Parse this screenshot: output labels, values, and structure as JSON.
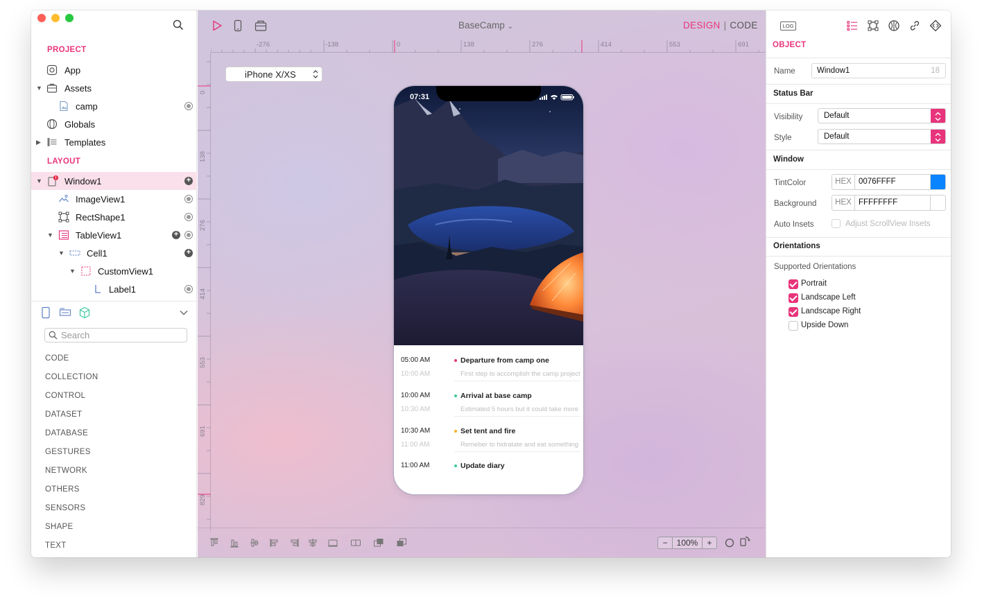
{
  "window": {
    "title": "BaseCamp"
  },
  "left_panel": {
    "project_title": "PROJECT",
    "project_items": [
      {
        "label": "App"
      },
      {
        "label": "Assets"
      },
      {
        "label": "camp"
      },
      {
        "label": "Globals"
      },
      {
        "label": "Templates"
      }
    ],
    "layout_title": "LAYOUT",
    "layout_items": [
      {
        "label": "Window1",
        "selected": true
      },
      {
        "label": "ImageView1"
      },
      {
        "label": "RectShape1"
      },
      {
        "label": "TableView1"
      },
      {
        "label": "Cell1"
      },
      {
        "label": "CustomView1"
      },
      {
        "label": "Label1"
      }
    ],
    "search_placeholder": "Search",
    "library_categories": [
      "CODE",
      "COLLECTION",
      "CONTROL",
      "DATASET",
      "DATABASE",
      "GESTURES",
      "NETWORK",
      "OTHERS",
      "SENSORS",
      "SHAPE",
      "TEXT"
    ]
  },
  "canvas": {
    "mode_design": "DESIGN",
    "mode_separator": "|",
    "mode_code": "CODE",
    "ruler_h": [
      "-276",
      "-138",
      "0",
      "138",
      "276",
      "414",
      "553",
      "691"
    ],
    "ruler_v": [
      "0",
      "138",
      "276",
      "414",
      "553",
      "691",
      "829"
    ],
    "device": "iPhone X/XS",
    "zoom": "100%",
    "zoom_minus": "−",
    "zoom_plus": "+"
  },
  "phone": {
    "time": "07:31",
    "timeline": [
      {
        "start": "05:00 AM",
        "end": "10:00 AM",
        "title": "Departure from camp one",
        "desc": "First step to accomplish the camp project",
        "dot": "#e8347b"
      },
      {
        "start": "10:00 AM",
        "end": "10:30 AM",
        "title": "Arrival at base camp",
        "desc": "Estimated 5 hours but it could take more",
        "dot": "#3cc7a0"
      },
      {
        "start": "10:30 AM",
        "end": "11:00 AM",
        "title": "Set tent and fire",
        "desc": "Remeber to hidratate and eat something",
        "dot": "#f4b321"
      },
      {
        "start": "11:00 AM",
        "end": "",
        "title": "Update diary",
        "desc": "",
        "dot": "#3cc7a0"
      }
    ]
  },
  "inspector": {
    "log_label": "LOG",
    "section_title": "OBJECT",
    "name_label": "Name",
    "name_value": "Window1",
    "name_count": "18",
    "status_bar_title": "Status Bar",
    "visibility_label": "Visibility",
    "visibility_value": "Default",
    "style_label": "Style",
    "style_value": "Default",
    "window_title": "Window",
    "tint_label": "TintColor",
    "tint_hex_label": "HEX",
    "tint_value": "0076FFFF",
    "tint_color": "#0076FF",
    "bg_label": "Background",
    "bg_hex_label": "HEX",
    "bg_value": "FFFFFFFF",
    "bg_color": "#FFFFFF",
    "auto_insets_label": "Auto Insets",
    "adjust_label": "Adjust ScrollView Insets",
    "orientations_title": "Orientations",
    "supported_label": "Supported Orientations",
    "orientations": [
      {
        "label": "Portrait",
        "checked": true
      },
      {
        "label": "Landscape Left",
        "checked": true
      },
      {
        "label": "Landscape Right",
        "checked": true
      },
      {
        "label": "Upside Down",
        "checked": false
      }
    ]
  },
  "colors": {
    "accent": "#e8347b",
    "selection": "#fae0ea"
  }
}
